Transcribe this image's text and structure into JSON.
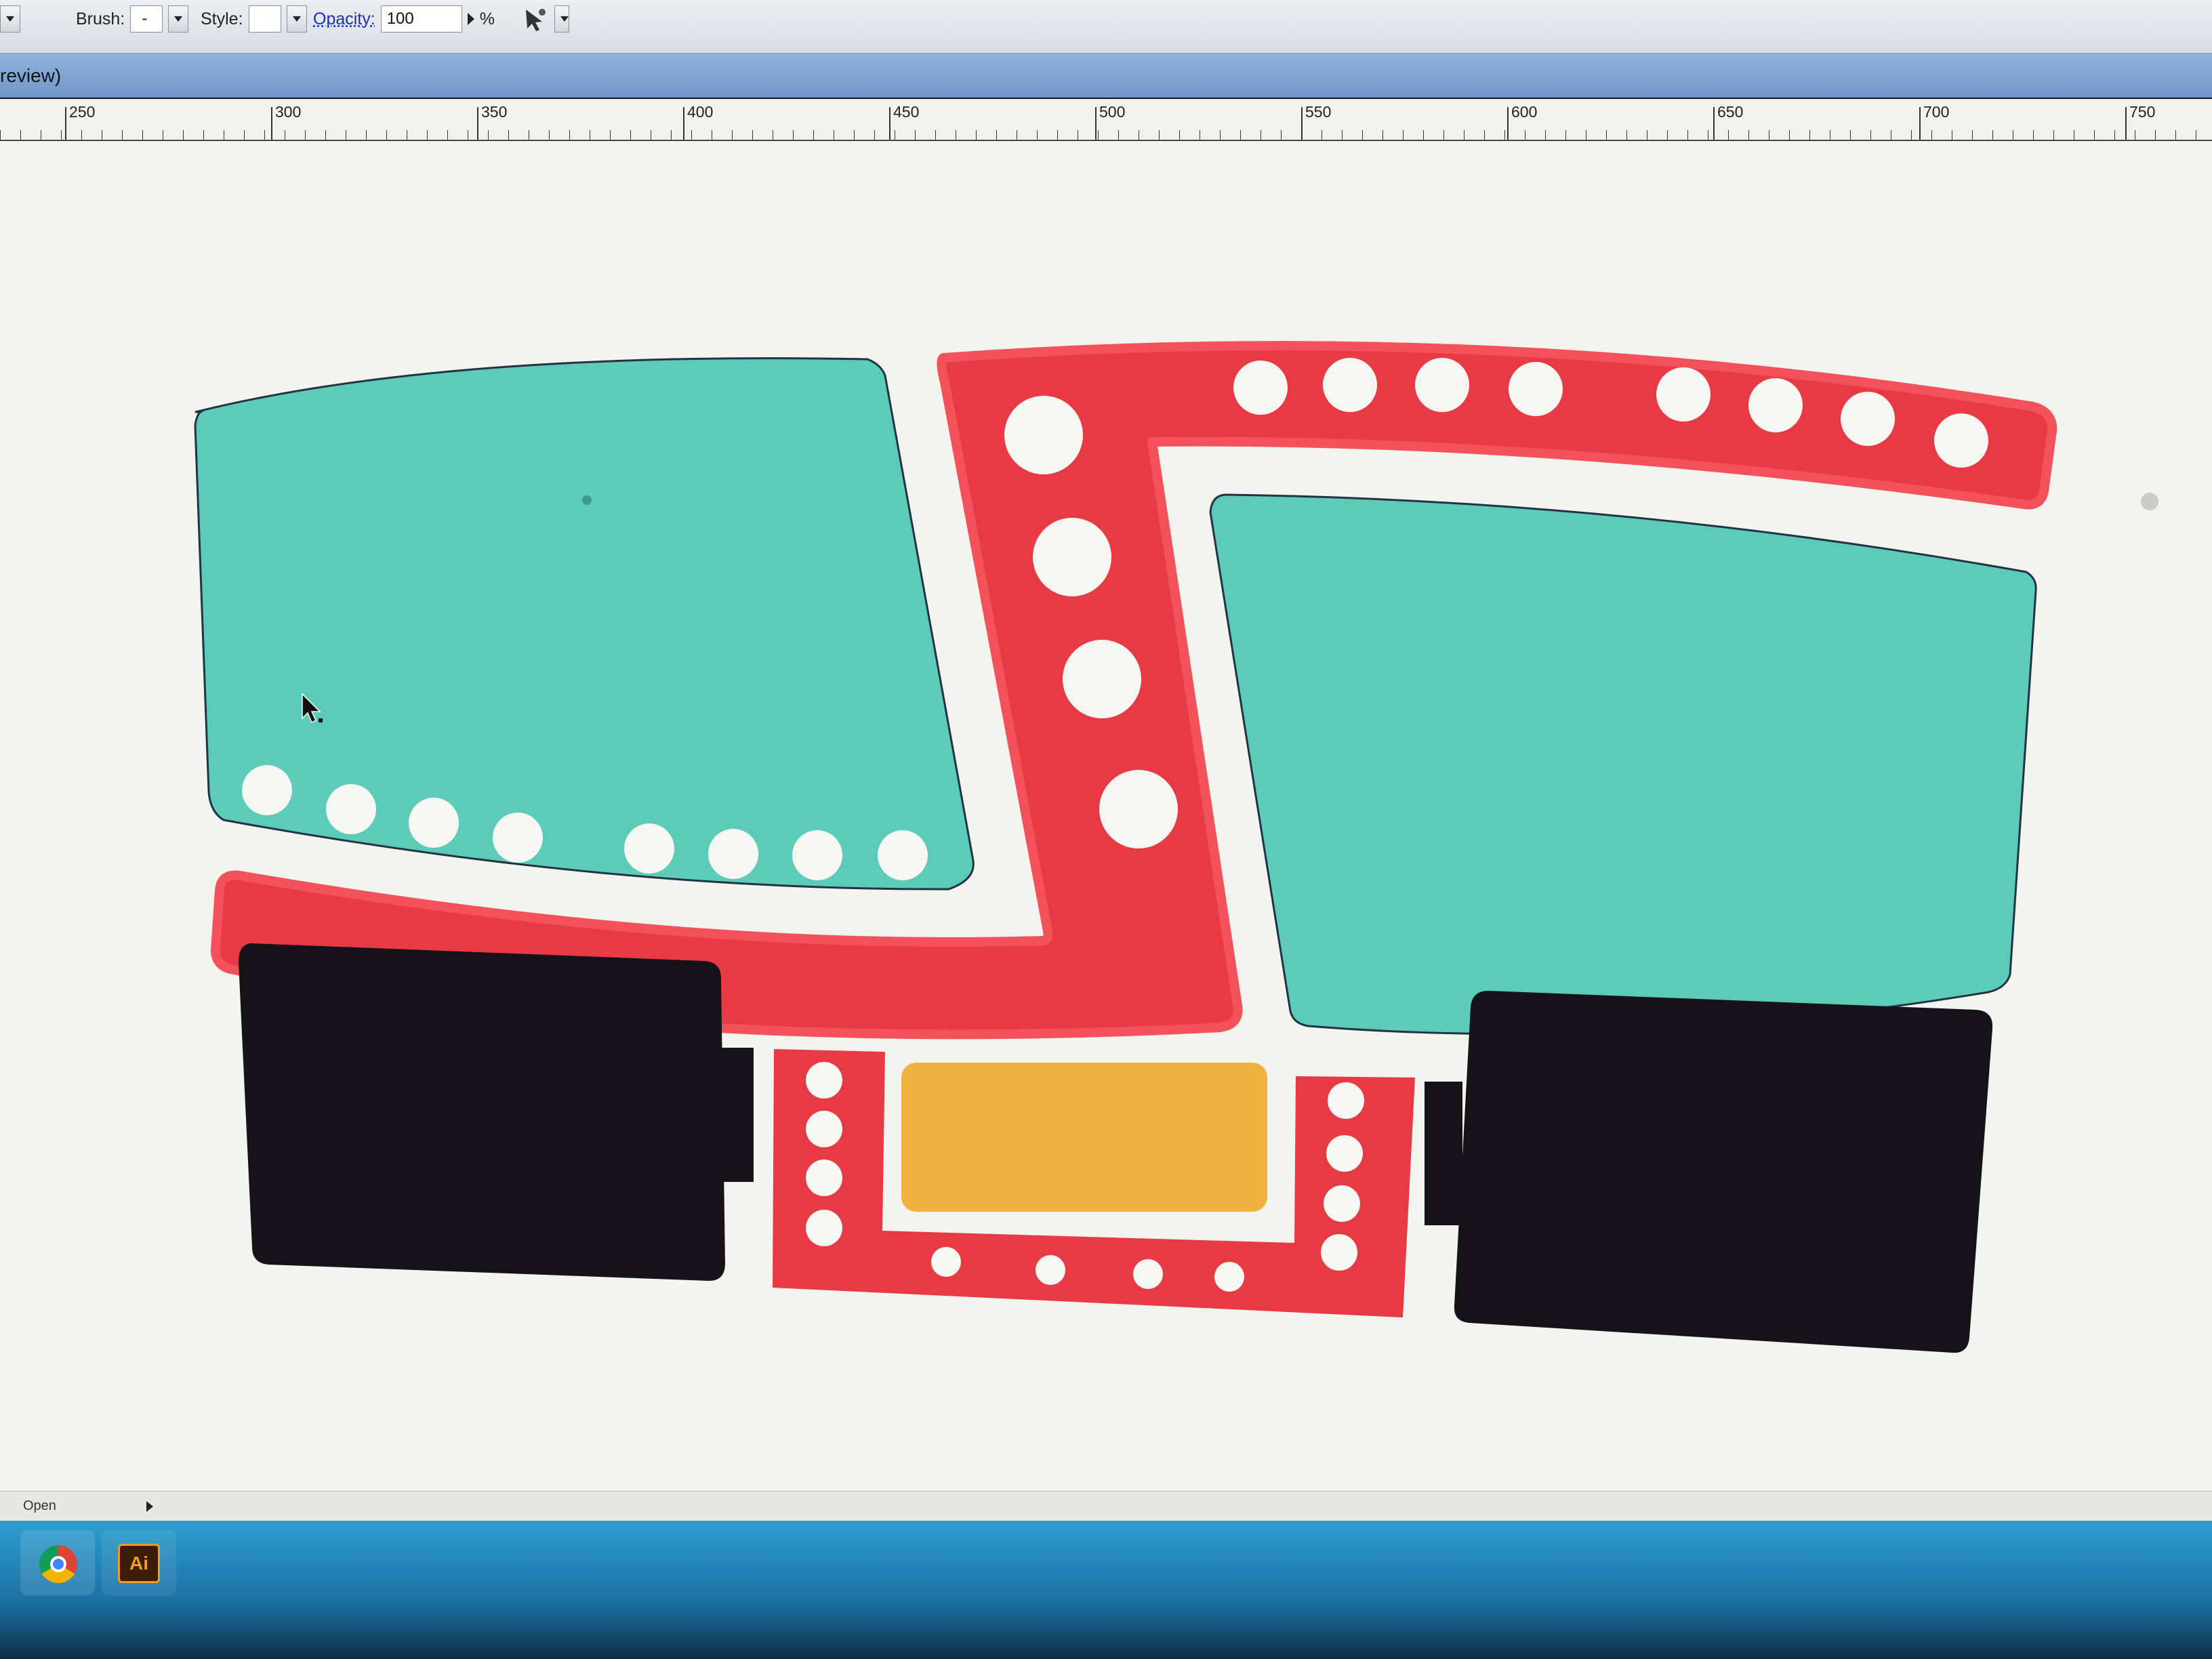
{
  "control_bar": {
    "brush_label": "Brush:",
    "brush_value": "-",
    "style_label": "Style:",
    "opacity_label": "Opacity:",
    "opacity_value": "100",
    "percent_sign": "%"
  },
  "document_tab": {
    "title_fragment": "review)"
  },
  "ruler": {
    "labels": [
      "250",
      "300",
      "350",
      "400",
      "450",
      "500",
      "550",
      "600",
      "650",
      "700",
      "750"
    ]
  },
  "artwork": {
    "colors": {
      "teal": "#5ccbb8",
      "red": "#ea3d45",
      "red_outline": "#f0464c",
      "black": "#16121a",
      "yellow": "#f1b33f",
      "hole": "#f6f6f2"
    }
  },
  "status_bar": {
    "text": "Open"
  },
  "taskbar": {
    "apps": [
      {
        "name": "chrome-icon",
        "label": ""
      },
      {
        "name": "illustrator-icon",
        "label": "Ai"
      }
    ]
  }
}
